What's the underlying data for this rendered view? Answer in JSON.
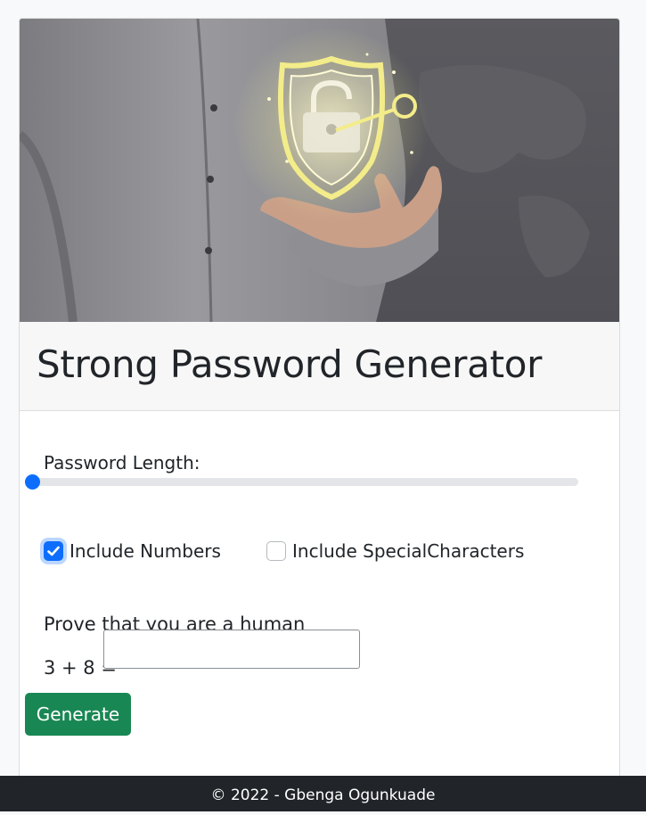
{
  "app": {
    "title": "Strong Password Generator"
  },
  "hero_image": {
    "subject": "hand holding glowing shield with padlock and key"
  },
  "form": {
    "length_label": "Password Length:",
    "length_fraction": 0.0,
    "include_numbers": {
      "label": "Include Numbers",
      "checked": true
    },
    "include_special": {
      "label": "Include SpecialCharacters",
      "checked": false
    },
    "human_prompt": "Prove that you are a human",
    "captcha_question": "3 + 8 =",
    "captcha_value": "",
    "generate_label": "Generate"
  },
  "footer": {
    "text": "© 2022 - Gbenga Ogunkuade"
  },
  "colors": {
    "primary": "#0d6efd",
    "success": "#198754",
    "footer_bg": "#212529"
  },
  "icons": {
    "checkbox_checked": "check-icon",
    "hero": "shield-lock-icon"
  }
}
